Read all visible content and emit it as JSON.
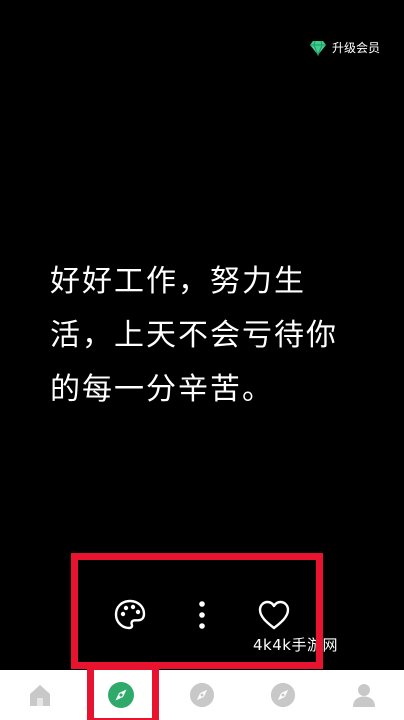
{
  "header": {
    "upgrade_label": "升级会员",
    "upgrade_icon": "diamond-icon",
    "upgrade_icon_color": "#3ecf8e"
  },
  "quote": {
    "text": "好好工作，努力生活，上天不会亏待你的每一分辛苦。"
  },
  "actions": [
    {
      "icon": "palette-icon"
    },
    {
      "icon": "more-vertical-icon"
    },
    {
      "icon": "heart-outline-icon"
    }
  ],
  "watermark": "4k4k手游网",
  "tabbar": {
    "tabs": [
      {
        "icon": "home-icon",
        "active": false
      },
      {
        "icon": "compass-icon",
        "active": true
      },
      {
        "icon": "compass-icon",
        "active": false
      },
      {
        "icon": "compass-icon",
        "active": false
      },
      {
        "icon": "profile-icon",
        "active": false
      }
    ],
    "active_color": "#2faa6b",
    "inactive_color": "#c8c8c8"
  },
  "highlight_color": "#e8132e"
}
